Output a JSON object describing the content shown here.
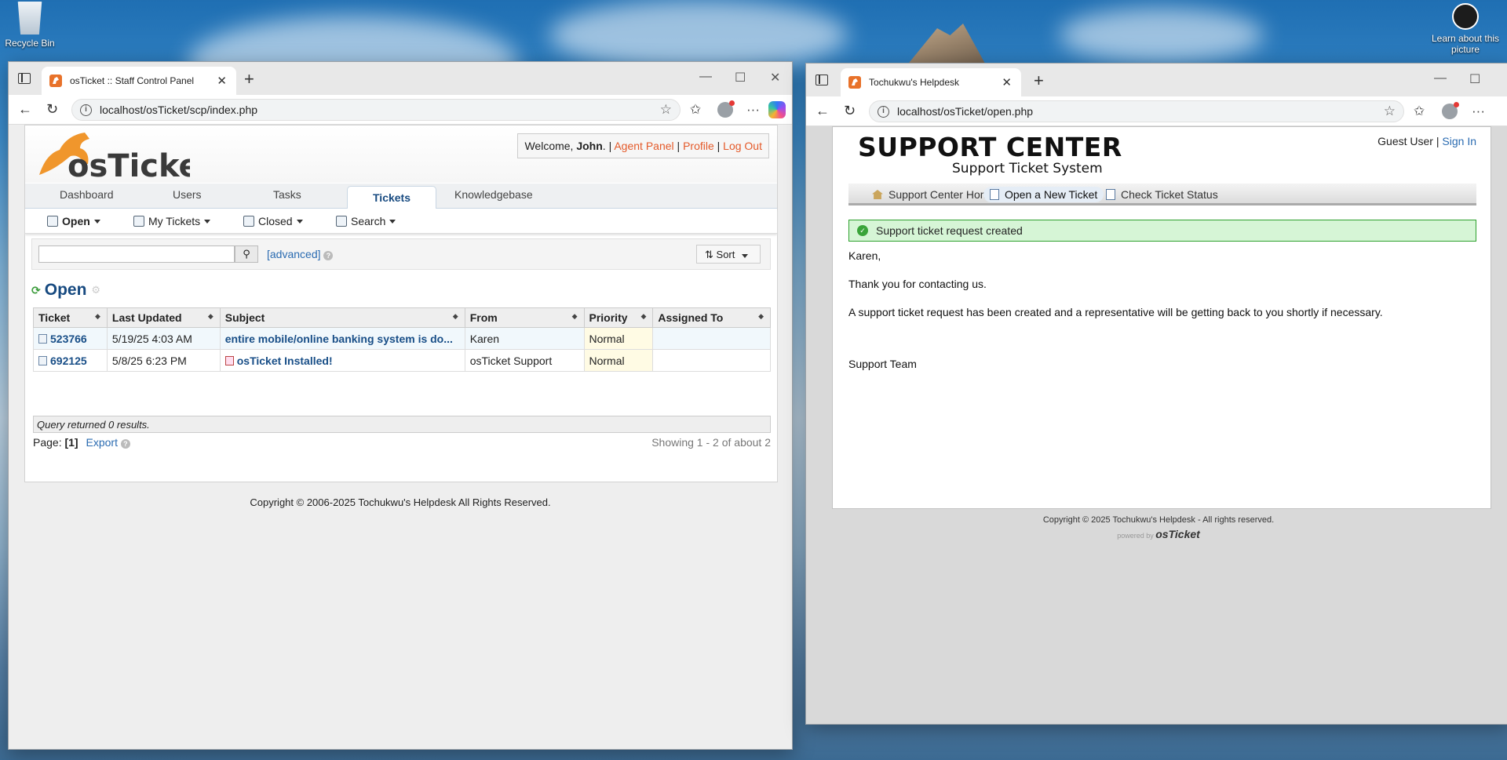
{
  "desktop": {
    "recycle_bin_label": "Recycle Bin",
    "learn_label": "Learn about this picture"
  },
  "staff_window": {
    "tab_title": "osTicket :: Staff Control Panel",
    "url": "localhost/osTicket/scp/index.php",
    "welcome": {
      "prefix": "Welcome,",
      "name": "John",
      "suffix": ". |",
      "agent_panel": "Agent Panel",
      "profile": "Profile",
      "logout": "Log Out",
      "sep": "|"
    },
    "main_nav": [
      "Dashboard",
      "Users",
      "Tasks",
      "Tickets",
      "Knowledgebase"
    ],
    "sub_nav": [
      "Open",
      "My Tickets",
      "Closed",
      "Search"
    ],
    "search": {
      "value": "",
      "advanced": "[advanced]",
      "sort": "Sort"
    },
    "queue_title": "Open",
    "table": {
      "headers": [
        "Ticket",
        "Last Updated",
        "Subject",
        "From",
        "Priority",
        "Assigned To"
      ],
      "rows": [
        {
          "ticket": "523766",
          "updated": "5/19/25 4:03 AM",
          "subject": "entire mobile/online banking system is do...",
          "from": "Karen",
          "priority": "Normal",
          "assigned": ""
        },
        {
          "ticket": "692125",
          "updated": "5/8/25 6:23 PM",
          "subject": "osTicket Installed!",
          "from": "osTicket Support",
          "priority": "Normal",
          "assigned": ""
        }
      ]
    },
    "query_note": "Query returned 0 results.",
    "page_label": "Page:",
    "page_current": "[1]",
    "export": "Export",
    "showing": "Showing 1 - 2 of about 2",
    "copyright": "Copyright © 2006-2025 Tochukwu's Helpdesk All Rights Reserved."
  },
  "client_window": {
    "tab_title": "Tochukwu's Helpdesk",
    "url": "localhost/osTicket/open.php",
    "brand_big": "SUPPORT CENTER",
    "brand_small": "Support Ticket System",
    "guest_user": "Guest User",
    "sep": "|",
    "sign_in": "Sign In",
    "nav": [
      "Support Center Home",
      "Open a New Ticket",
      "Check Ticket Status"
    ],
    "notice": "Support ticket request created",
    "greeting": "Karen,",
    "line1": "Thank you for contacting us.",
    "line2": "A support ticket request has been created and a representative will be getting back to you shortly if necessary.",
    "signoff": "Support Team",
    "copyright": "Copyright © 2025 Tochukwu's Helpdesk - All rights reserved.",
    "powered_by": "powered by",
    "powered_brand": "osTicket"
  },
  "colors": {
    "link_orange": "#e45a2a",
    "link_blue": "#2a6bb1",
    "nav_active": "#174a80",
    "notice_green": "#d6f5d6"
  }
}
